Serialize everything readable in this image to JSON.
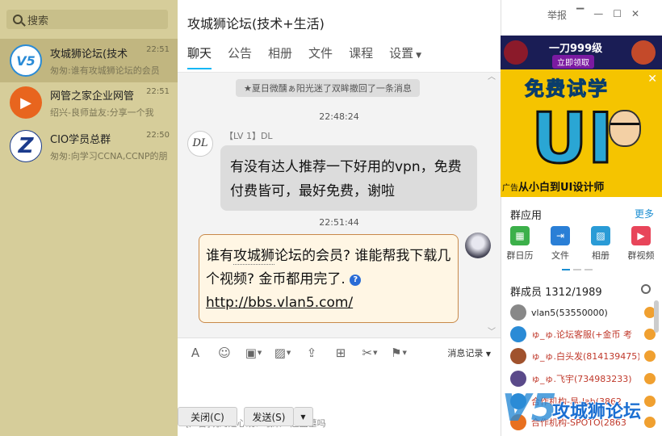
{
  "search": {
    "label": "搜索"
  },
  "conversations": [
    {
      "name": "攻城狮论坛(技术",
      "time": "22:51",
      "preview": "匆匆:谁有攻城狮论坛的会员",
      "avatar_text": "V5",
      "avatar_color": "#2a8bd6"
    },
    {
      "name": "网管之家企业网管",
      "time": "22:51",
      "preview": "绍兴-良师益友:分享一个我",
      "avatar_text": "▶",
      "avatar_color": "#e8651e"
    },
    {
      "name": "CIO学员总群",
      "time": "22:50",
      "preview": "匆匆:向学习CCNA,CCNP的朋",
      "avatar_text": "Z",
      "avatar_color": "#1b3b8c"
    }
  ],
  "chat": {
    "title": "攻城狮论坛(技术+生活)",
    "tabs": [
      "聊天",
      "公告",
      "相册",
      "文件",
      "课程",
      "设置"
    ],
    "recall_notice": "★夏日微醺ぁ阳光迷了双眸撤回了一条消息",
    "time1": "22:48:24",
    "sender": "【LV 1】DL",
    "msg1": "有没有达人推荐一下好用的vpn，免费付费皆可，最好免费，谢啦",
    "time2": "22:51:44",
    "msg2_part1": "谁有",
    "msg2_part2": "攻城狮",
    "msg2_part3": "论坛的会员? 谁能帮我下载几个视频? 金币都用完了.",
    "msg2_link": "http://bbs.vlan5.com/",
    "history": "消息记录",
    "ad_text": "[广告]玩的是心跳！敢来一起盗墓吗",
    "close_btn": "关闭(C)",
    "send_btn": "发送(S)"
  },
  "window": {
    "report": "举报"
  },
  "ads": {
    "top_title": "一刀999级",
    "top_button": "立即领取",
    "main_title": "免费试学",
    "main_big": "UI",
    "main_label_prefix": "广告",
    "main_label": "从小白到UI设计师"
  },
  "group_apps": {
    "title": "群应用",
    "more": "更多",
    "items": [
      {
        "label": "群日历",
        "color": "#3cb04a",
        "glyph": "▦"
      },
      {
        "label": "文件",
        "color": "#2a7fd6",
        "glyph": "⇥"
      },
      {
        "label": "相册",
        "color": "#2a9bd6",
        "glyph": "▨"
      },
      {
        "label": "群视频",
        "color": "#e8455a",
        "glyph": "▶"
      }
    ]
  },
  "members": {
    "title": "群成员 1312/1989",
    "items": [
      {
        "name": "vlan5(53550000)",
        "color": "#222",
        "av": "#888"
      },
      {
        "name": "ゅ_ゅ.论坛客服(+金币 考",
        "color": "#c0392b",
        "av": "#2a8bd6"
      },
      {
        "name": "ゅ_ゅ.白头发(814139475)",
        "color": "#c0392b",
        "av": "#a0522d"
      },
      {
        "name": "ゅ_ゅ.飞宇(734983233)",
        "color": "#c0392b",
        "av": "#5a4a8a"
      },
      {
        "name": "合作机构-易-lab(3862",
        "color": "#c0392b",
        "av": "#2a8bd6"
      },
      {
        "name": "合作机构-SPOTO(2863",
        "color": "#c0392b",
        "av": "#e87020"
      }
    ]
  },
  "watermark": {
    "logo": "V5",
    "text": "攻城狮论坛"
  }
}
